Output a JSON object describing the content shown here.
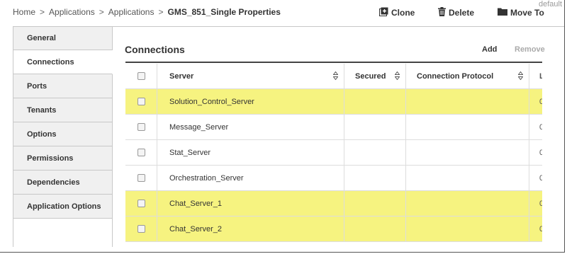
{
  "breadcrumb": {
    "items": [
      "Home",
      "Applications",
      "Applications"
    ],
    "separator": ">",
    "current": "GMS_851_Single Properties"
  },
  "corner_label": "default",
  "toolbar": {
    "clone_label": "Clone",
    "delete_label": "Delete",
    "move_label": "Move To"
  },
  "sidebar": {
    "items": [
      {
        "label": "General",
        "active": false
      },
      {
        "label": "Connections",
        "active": true
      },
      {
        "label": "Ports",
        "active": false
      },
      {
        "label": "Tenants",
        "active": false
      },
      {
        "label": "Options",
        "active": false
      },
      {
        "label": "Permissions",
        "active": false
      },
      {
        "label": "Dependencies",
        "active": false
      },
      {
        "label": "Application Options",
        "active": false
      }
    ]
  },
  "connections": {
    "title": "Connections",
    "add_label": "Add",
    "remove_label": "Remove",
    "columns": {
      "server": "Server",
      "secured": "Secured",
      "protocol": "Connection Protocol",
      "extra": "L"
    },
    "rows": [
      {
        "server": "Solution_Control_Server",
        "secured": "",
        "protocol": "",
        "extra": "0",
        "highlighted": true
      },
      {
        "server": "Message_Server",
        "secured": "",
        "protocol": "",
        "extra": "0",
        "highlighted": false
      },
      {
        "server": "Stat_Server",
        "secured": "",
        "protocol": "",
        "extra": "0",
        "highlighted": false
      },
      {
        "server": "Orchestration_Server",
        "secured": "",
        "protocol": "",
        "extra": "0",
        "highlighted": false
      },
      {
        "server": "Chat_Server_1",
        "secured": "",
        "protocol": "",
        "extra": "0",
        "highlighted": true
      },
      {
        "server": "Chat_Server_2",
        "secured": "",
        "protocol": "",
        "extra": "0",
        "highlighted": true
      }
    ]
  },
  "colors": {
    "highlight": "#f6f380",
    "sidebar_bg": "#f0f0f0",
    "border": "#c8c8c8"
  }
}
